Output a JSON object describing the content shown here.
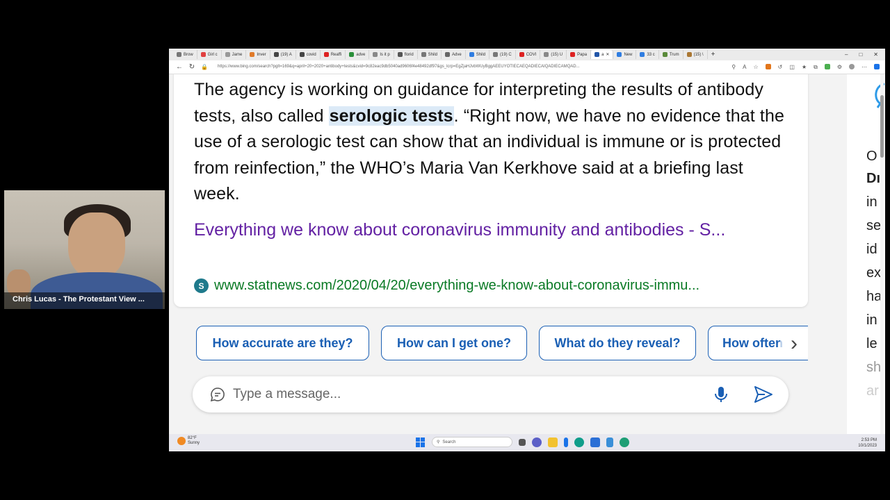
{
  "webcam": {
    "caption": "Chris Lucas - The Protestant View ..."
  },
  "browser": {
    "tabs": [
      "Brow",
      "Girl c",
      "Jame",
      "Inver",
      "(19) A",
      "covid",
      "Reaffi",
      "adve",
      "Is it p",
      "florid",
      "Shild",
      "Adve",
      "Shild",
      "(19) C",
      "COVI",
      "(15) U",
      "Papa",
      "a",
      "New",
      "33 c",
      "Trum",
      "(15) \\"
    ],
    "active_tab_index": 17,
    "new_tab_label": "+",
    "window_controls": [
      "–",
      "□",
      "✕"
    ],
    "url": "https://www.bing.com/search?pglt=169&q=april+20+2020+antibody+tests&cvid=9c82eac9db5040ad9606f4e48492df97&gs_lcrp=EgZjaHJvbWUyBggAEEUYOTIECAEQADIECAIQADIECAMQAD..."
  },
  "answer": {
    "snippet_before": "The agency is working on guidance for interpreting the results of antibody tests, also called ",
    "snippet_highlight": "serologic tests",
    "snippet_after": ". “Right now, we have no evidence that the use of a serologic test can show that an individual is immune or is protected from reinfection,” the WHO’s Maria Van Kerkhove said at a briefing last week.",
    "result_title": "Everything we know about coronavirus immunity and antibodies - S...",
    "source_icon_letter": "S",
    "source_url": "www.statnews.com/2020/04/20/everything-we-know-about-coronavirus-immu..."
  },
  "suggestions": [
    "How accurate are they?",
    "How can I get one?",
    "What do they reveal?",
    "How often"
  ],
  "composer": {
    "placeholder": "Type a message..."
  },
  "right_pane_glyphs": [
    "O",
    "Dı",
    "in",
    "se",
    "id",
    "ex",
    "ha",
    "in",
    "le",
    "sh",
    "ar"
  ],
  "taskbar": {
    "weather_temp": "82°F",
    "weather_desc": "Sunny",
    "search_label": "Search",
    "time": "2:53 PM",
    "date": "10/1/2023"
  },
  "colors": {
    "accent_link": "#1a5fb4",
    "result_title": "#6321a3",
    "source_url": "#0a7a25",
    "highlight": "#dceaf7"
  }
}
